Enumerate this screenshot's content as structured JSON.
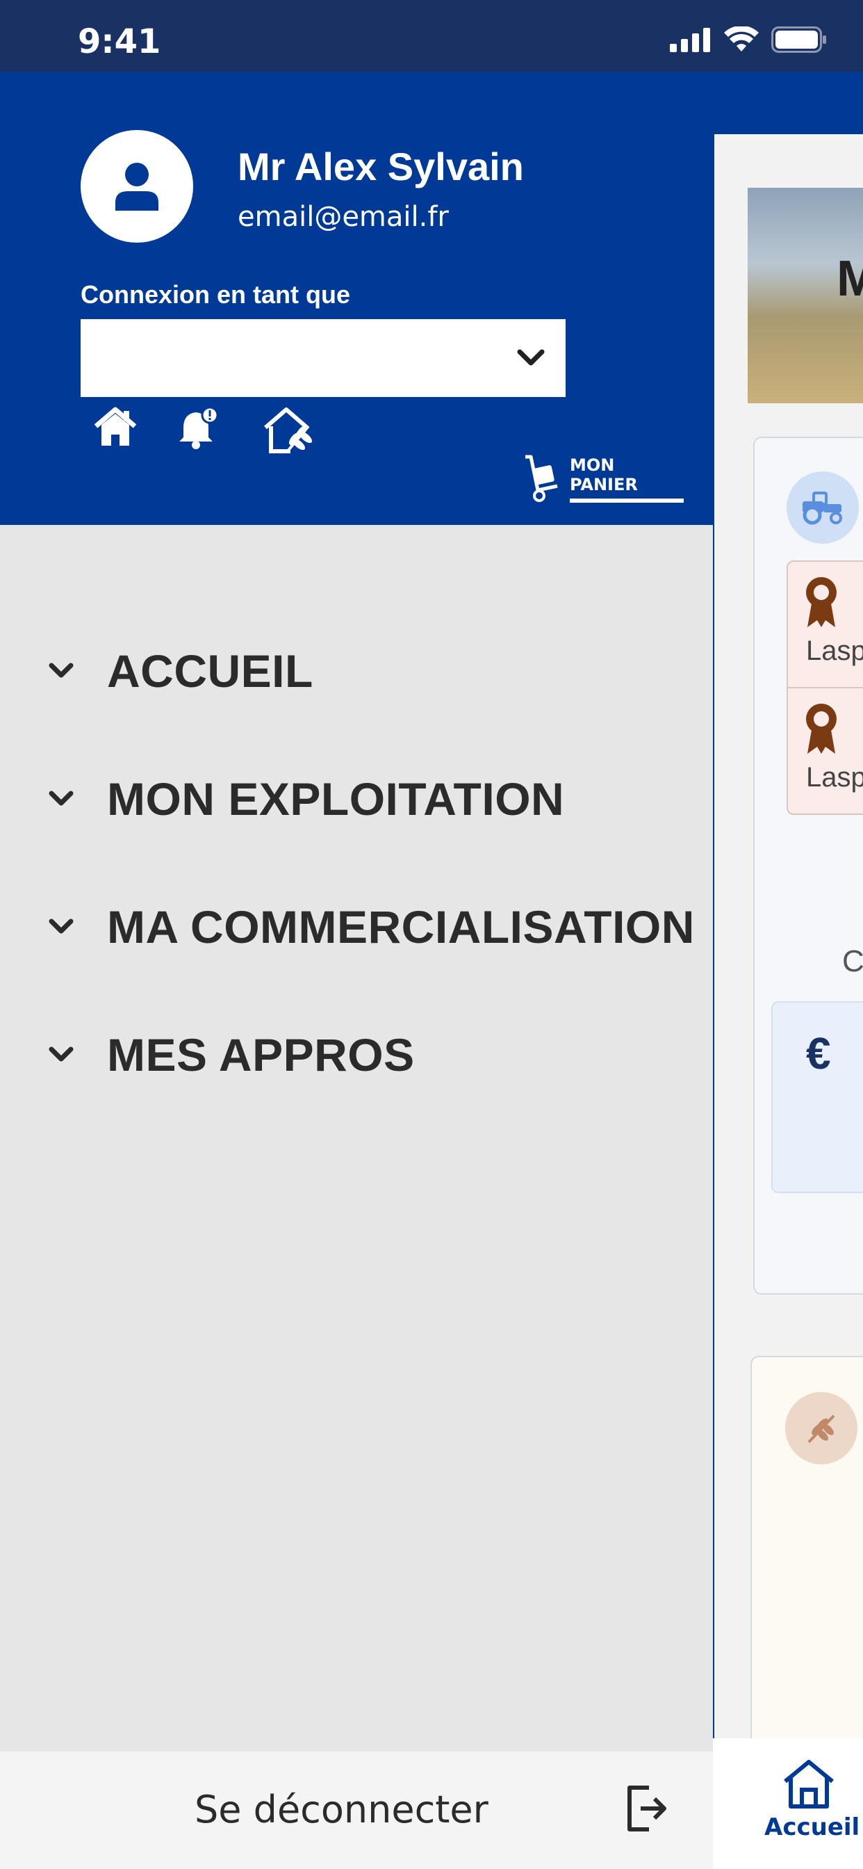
{
  "status_bar": {
    "time": "9:41",
    "icons": [
      "signal-icon",
      "wifi-icon",
      "battery-icon"
    ]
  },
  "drawer": {
    "user": {
      "name": "Mr Alex Sylvain",
      "email": "email@email.fr",
      "avatar_icon": "user-icon"
    },
    "connexion": {
      "label": "Connexion en tant que",
      "value": ""
    },
    "shortcuts": [
      "home-icon",
      "bell-alert-icon",
      "farm-icon"
    ],
    "cart": {
      "label": "MON PANIER",
      "icon": "hand-truck-icon"
    },
    "menu": [
      {
        "label": "ACCUEIL"
      },
      {
        "label": "MON EXPLOITATION"
      },
      {
        "label": "MA COMMERCIALISATION"
      },
      {
        "label": "MES APPROS"
      }
    ],
    "logout": {
      "label": "Se déconnecter",
      "icon": "logout-icon"
    }
  },
  "background_app": {
    "hero_letter": "M",
    "certifications": [
      {
        "text": "Lasp"
      },
      {
        "text": "Lasp"
      }
    ],
    "c_letter": "C",
    "euro": "€",
    "tab": {
      "label": "Accueil",
      "icon": "home-outline-icon"
    }
  },
  "colors": {
    "primary": "#003a96",
    "status_bar": "#1a3263",
    "drawer_bg": "#e6e6e6",
    "text_dark": "#2b2b2b"
  }
}
